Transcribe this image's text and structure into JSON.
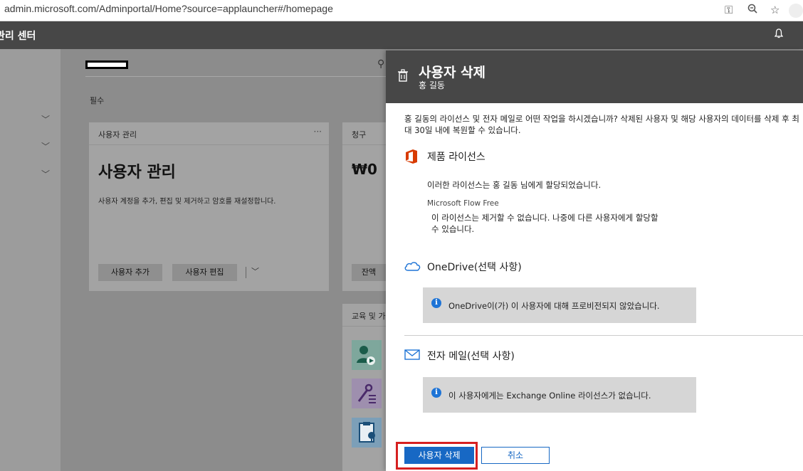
{
  "browser": {
    "url": "admin.microsoft.com/Adminportal/Home?source=applauncher#/homepage"
  },
  "header": {
    "title": "관리 센터"
  },
  "dashboard": {
    "section_label": "필수",
    "user_card": {
      "head": "사용자 관리",
      "more": "···",
      "big_title": "사용자 관리",
      "description": "사용자 계정을 추가, 편집 및 제거하고 암호를 재설정합니다.",
      "add_button": "사용자 추가",
      "edit_button": "사용자 편집"
    },
    "billing_card": {
      "head": "청구",
      "amount": "₩0",
      "balance_button": "잔액"
    },
    "training_card": {
      "head": "교육 및 가"
    }
  },
  "panel": {
    "title": "사용자 삭제",
    "subtitle": "홍 길동",
    "intro": "홍 길동의 라이선스 및 전자 메일로 어떤 작업을 하시겠습니까? 삭제된 사용자 및 해당 사용자의 데이터를 삭제 후 최대 30일 내에 복원할 수 있습니다.",
    "licenses": {
      "title": "제품 라이선스",
      "assigned_text": "이러한 라이선스는 홍 길동 님에게 할당되었습니다.",
      "license_name": "Microsoft Flow Free",
      "license_note": "이 라이선스는 제거할 수 없습니다. 나중에 다른 사용자에게 할당할 수 있습니다."
    },
    "onedrive": {
      "title": "OneDrive(선택 사항)",
      "info": "OneDrive이(가) 이 사용자에 대해 프로비전되지 않았습니다."
    },
    "email": {
      "title": "전자 메일(선택 사항)",
      "info": "이 사용자에게는 Exchange Online 라이선스가 없습니다."
    },
    "delete_button": "사용자 삭제",
    "cancel_button": "취소"
  },
  "colors": {
    "header_bg": "#474747",
    "primary": "#1768c4",
    "info_icon": "#1e74d6",
    "highlight": "#d62020",
    "office_icon": "#d83b01"
  }
}
